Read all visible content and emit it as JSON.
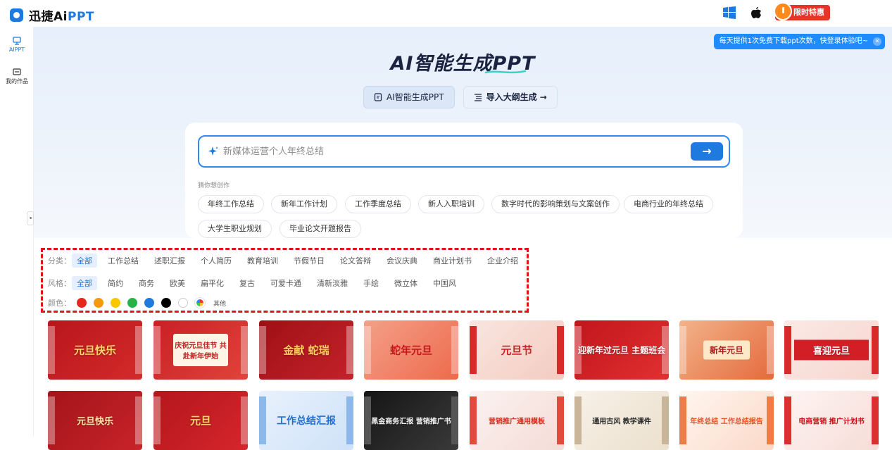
{
  "app": {
    "name_main": "迅捷Ai",
    "name_accent": "PPT"
  },
  "header": {
    "icons": [
      "windows-icon",
      "apple-icon"
    ],
    "promo_label": "限时特惠"
  },
  "sidebar": {
    "items": [
      {
        "label": "AIPPT",
        "icon": "presentation-icon",
        "active": true
      },
      {
        "label": "我的作品",
        "icon": "folder-icon",
        "active": false
      }
    ],
    "collapse_glyph": "◂"
  },
  "notice": {
    "text": "每天提供1次免费下载ppt次数，快登录体验吧~",
    "close_glyph": "✕"
  },
  "hero": {
    "title": "AI智能生成PPT",
    "tabs": [
      {
        "label": "AI智能生成PPT",
        "icon": "doc-icon"
      },
      {
        "label": "导入大纲生成 →",
        "icon": "outline-icon"
      }
    ]
  },
  "search": {
    "placeholder": "新媒体运营个人年终总结",
    "submit_glyph": "→"
  },
  "suggestions": {
    "label": "猜你想创作",
    "chips": [
      "年终工作总结",
      "新年工作计划",
      "工作季度总结",
      "新人入职培训",
      "数字时代的影响策划与文案创作",
      "电商行业的年终总结",
      "大学生职业规划",
      "毕业论文开题报告"
    ]
  },
  "filters": {
    "category": {
      "label": "分类：",
      "options": [
        "全部",
        "工作总结",
        "述职汇报",
        "个人简历",
        "教育培训",
        "节假节日",
        "论文答辩",
        "会议庆典",
        "商业计划书",
        "企业介绍"
      ],
      "selected": "全部"
    },
    "style": {
      "label": "风格：",
      "options": [
        "全部",
        "简约",
        "商务",
        "欧美",
        "扁平化",
        "复古",
        "可爱卡通",
        "清新淡雅",
        "手绘",
        "微立体",
        "中国风"
      ],
      "selected": "全部"
    },
    "color": {
      "label": "颜色：",
      "swatches": [
        "#e8261e",
        "#f59a0d",
        "#f7c800",
        "#27b34a",
        "#1f7ae0",
        "#000000",
        "#ffffff",
        "multicolor"
      ],
      "other_label": "其他"
    }
  },
  "templates": {
    "row1": [
      "元旦快乐",
      "庆祝元旦佳节 共赴新年伊始",
      "金献 蛇瑞",
      "蛇年元旦",
      "元旦节",
      "迎新年过元旦 主题班会",
      "新年元旦",
      "喜迎元旦"
    ],
    "row2": [
      "元旦快乐",
      "元旦",
      "工作总结汇报",
      "黑金商务汇报 营销推广书",
      "营销推广通用模板",
      "通用古风 教学课件",
      "年终总结 工作总结报告",
      "电商营销 推广计划书"
    ]
  }
}
